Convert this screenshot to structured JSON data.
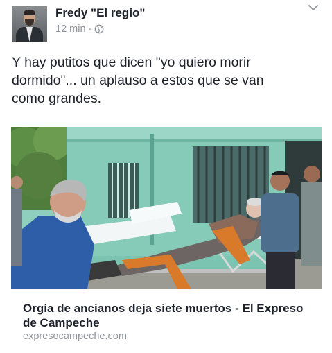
{
  "post": {
    "author": "Fredy \"El regio\"",
    "time": "12 min",
    "separator": "·",
    "privacy_icon": "globe-icon",
    "menu_icon": "chevron-down-icon",
    "text": "Y hay putitos que dicen \"yo quiero morir\ndormido\"... un aplauso a estos que se van\ncomo grandes."
  },
  "link": {
    "title": "Orgía de ancianos deja siete muertos - El Expreso de Campeche",
    "domain": "expresocampeche.com"
  },
  "colors": {
    "text": "#1d2129",
    "muted": "#90949c",
    "wall": "#7fc7b4"
  }
}
